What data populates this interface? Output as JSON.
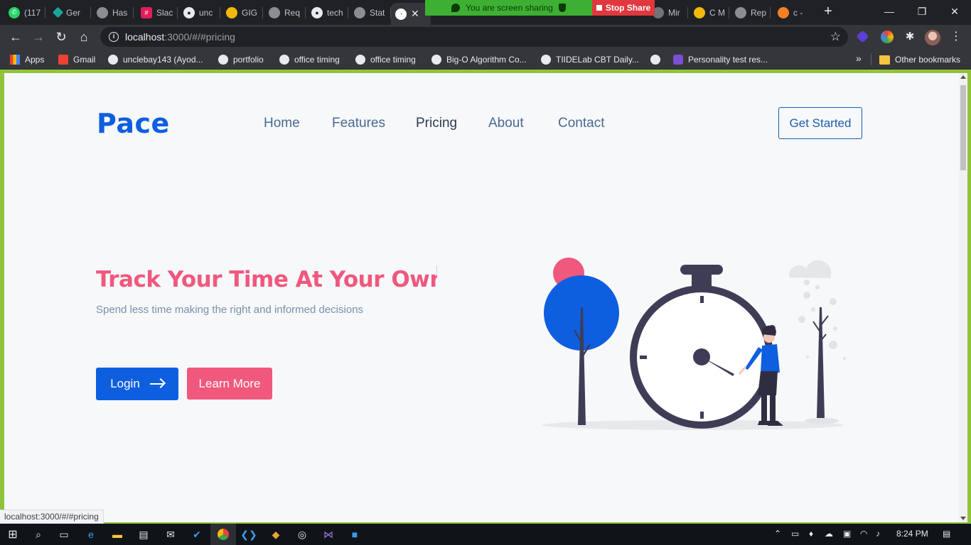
{
  "browser": {
    "tabs": [
      {
        "label": "(117",
        "color": "#25d366"
      },
      {
        "label": "Ger",
        "color": "#1aa59b"
      },
      {
        "label": "Has",
        "color": "#8a8d92"
      },
      {
        "label": "Slac",
        "color": "#e01e5a"
      },
      {
        "label": "unc",
        "color": "#e8eaed"
      },
      {
        "label": "GIG",
        "color": "#f2b90c"
      },
      {
        "label": "Req",
        "color": "#8a8d92"
      },
      {
        "label": "tech",
        "color": "#e8eaed"
      },
      {
        "label": "Stat",
        "color": "#8a8d92"
      },
      {
        "label": "",
        "color": "#ffffff"
      },
      {
        "label": "Mir",
        "color": "#e8eaed"
      },
      {
        "label": "C M",
        "color": "#f2b90c"
      },
      {
        "label": "Rep",
        "color": "#8a8d92"
      },
      {
        "label": "c -",
        "color": "#f48024"
      }
    ],
    "share_banner": "You are screen sharing",
    "stop_share": "Stop Share",
    "url_host": "localhost",
    "url_rest": ":3000/#/#pricing",
    "bookmarks": [
      {
        "label": "Apps"
      },
      {
        "label": "Gmail"
      },
      {
        "label": "unclebay143 (Ayod..."
      },
      {
        "label": "portfolio"
      },
      {
        "label": "office timing"
      },
      {
        "label": "office timing"
      },
      {
        "label": "Big-O Algorithm Co..."
      },
      {
        "label": "TIIDELab CBT Daily..."
      },
      {
        "label": ""
      },
      {
        "label": "Personality test res..."
      }
    ],
    "more_bookmarks": "»",
    "other_bookmarks": "Other bookmarks",
    "status_tip": "localhost:3000/#/#pricing"
  },
  "page": {
    "logo": "Pace",
    "nav": [
      "Home",
      "Features",
      "Pricing",
      "About",
      "Contact"
    ],
    "active_nav": "Pricing",
    "cta": "Get Started",
    "headline": "Track Your Time At Your Own Pac",
    "subline": "Spend less time making the right and informed decisions",
    "login_label": "Login",
    "learn_label": "Learn More",
    "colors": {
      "brand_blue": "#0d5fe0",
      "accent_pink": "#f0587e",
      "background": "#f6f8fa"
    }
  },
  "taskbar": {
    "clock": "8:24 PM",
    "icons": [
      "windows-start-icon",
      "search-icon",
      "task-view-icon",
      "edge-icon",
      "file-explorer-icon",
      "store-icon",
      "mail-icon",
      "todo-icon",
      "chrome-icon",
      "vscode-icon",
      "git-icon",
      "obs-icon",
      "visual-studio-icon",
      "zoom-icon"
    ]
  }
}
